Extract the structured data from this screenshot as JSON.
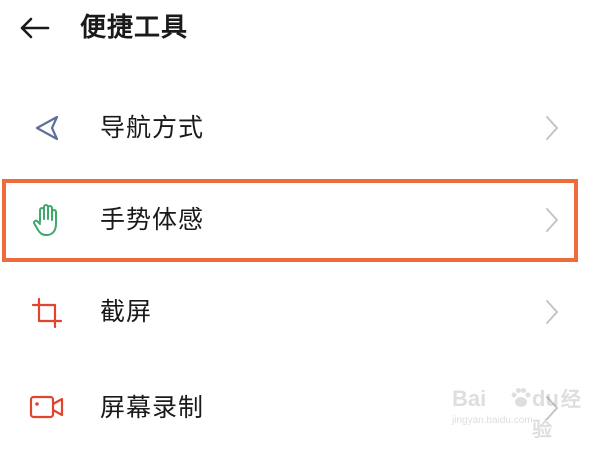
{
  "header": {
    "title": "便捷工具",
    "back_icon": "arrow-left-icon"
  },
  "items": [
    {
      "label": "导航方式",
      "icon": "navigation-triangle-icon",
      "icon_color": "#5f6f9a"
    },
    {
      "label": "手势体感",
      "icon": "hand-gesture-icon",
      "icon_color": "#3fa86b",
      "highlighted": true
    },
    {
      "label": "截屏",
      "icon": "crop-icon",
      "icon_color": "#e0452f"
    },
    {
      "label": "屏幕录制",
      "icon": "video-camera-icon",
      "icon_color": "#e0452f"
    }
  ],
  "colors": {
    "highlight_border": "#ee6b3b",
    "chevron": "#c4c4c4"
  },
  "watermark": {
    "brand": "Bai",
    "brand_suffix": "du",
    "sub": "经验",
    "url": "jingyan.baidu.com"
  }
}
